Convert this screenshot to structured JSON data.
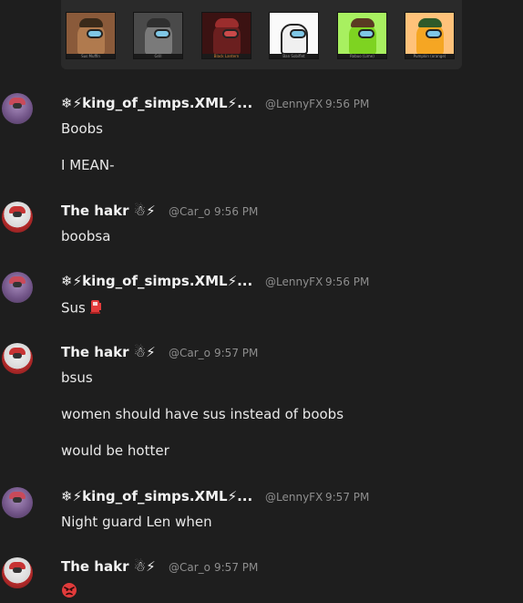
{
  "attachments": [
    {
      "caption": "Sus Muffin",
      "body": "#b07a4e",
      "hat": "#3a2a1a"
    },
    {
      "caption": "Grill",
      "body": "#7a7a7a",
      "hat": "#2f2f2f"
    },
    {
      "caption": "Black Lantern",
      "body": "#6b1f1f",
      "hat": "#9b2d2d"
    },
    {
      "caption": "Ban Sobiflet",
      "body": "#f0f0f0",
      "hat": "#d0d0d0"
    },
    {
      "caption": "Robuo (Lime)",
      "body": "#7ed321",
      "hat": "#5a3a22"
    },
    {
      "caption": "Pumpkin (orange)",
      "body": "#f5a623",
      "hat": "#2e5a2a"
    }
  ],
  "users": {
    "len": {
      "name": "❄⚡king_of_simps.XML⚡...",
      "handle": "@LennyFX"
    },
    "hakr": {
      "name": "The hakr ☃⚡",
      "handle": "@Car_o"
    }
  },
  "messages": [
    {
      "user": "len",
      "time": "9:56 PM",
      "lines": [
        "Boobs",
        "I MEAN-"
      ]
    },
    {
      "user": "hakr",
      "time": "9:56 PM",
      "lines": [
        "boobsa"
      ]
    },
    {
      "user": "len",
      "time": "9:56 PM",
      "lines": [
        "Sus"
      ]
    },
    {
      "user": "hakr",
      "time": "9:57 PM",
      "lines": [
        "bsus",
        "women should have sus instead of boobs",
        "would be hotter"
      ]
    },
    {
      "user": "len",
      "time": "9:57 PM",
      "lines": [
        "Night guard Len when"
      ]
    },
    {
      "user": "hakr",
      "time": "9:57 PM",
      "lines": [
        ""
      ]
    }
  ],
  "emoji": {
    "sus_emoji": "fuel-pump-icon",
    "angry_emoji": "angry-face-icon"
  },
  "colors": {
    "background": "#1e1e1e",
    "name": "#f2f2f2",
    "meta": "#8e8e8e",
    "text": "#e8e8e8"
  }
}
